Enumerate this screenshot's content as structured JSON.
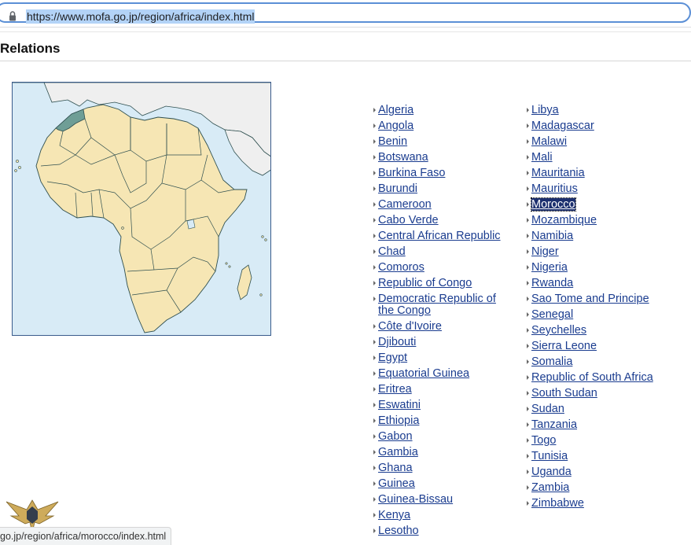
{
  "browser": {
    "url": "https://www.mofa.go.jp/region/africa/index.html",
    "status_url": "go.jp/region/africa/morocco/index.html"
  },
  "page": {
    "heading": "Relations"
  },
  "map": {
    "highlighted_country": "Morocco",
    "colors": {
      "ocean": "#d8ebf6",
      "land": "#f6e6b4",
      "border": "#2f4f4f",
      "highlight": "#6f9e96",
      "other_land": "#efefef"
    }
  },
  "countries": {
    "left": [
      "Algeria",
      "Angola",
      "Benin",
      "Botswana",
      "Burkina Faso",
      "Burundi",
      "Cameroon",
      "Cabo Verde",
      "Central African Republic",
      "Chad",
      "Comoros",
      "Republic of Congo",
      "Democratic Republic of the Congo",
      "Côte d'Ivoire",
      "Djibouti",
      "Egypt",
      "Equatorial Guinea",
      "Eritrea",
      "Eswatini",
      "Ethiopia",
      "Gabon",
      "Gambia",
      "Ghana",
      "Guinea",
      "Guinea-Bissau",
      "Kenya",
      "Lesotho"
    ],
    "right": [
      "Libya",
      "Madagascar",
      "Malawi",
      "Mali",
      "Mauritania",
      "Mauritius",
      "Morocco",
      "Mozambique",
      "Namibia",
      "Niger",
      "Nigeria",
      "Rwanda",
      "Sao Tome and Principe",
      "Senegal",
      "Seychelles",
      "Sierra Leone",
      "Somalia",
      "Republic of South Africa",
      "South Sudan",
      "Sudan",
      "Tanzania",
      "Togo",
      "Tunisia",
      "Uganda",
      "Zambia",
      "Zimbabwe"
    ],
    "active": "Morocco"
  },
  "icons": {
    "lock": "lock-icon",
    "bullet": "triangle-right-icon",
    "watermark": "eagle-logo-watermark"
  }
}
